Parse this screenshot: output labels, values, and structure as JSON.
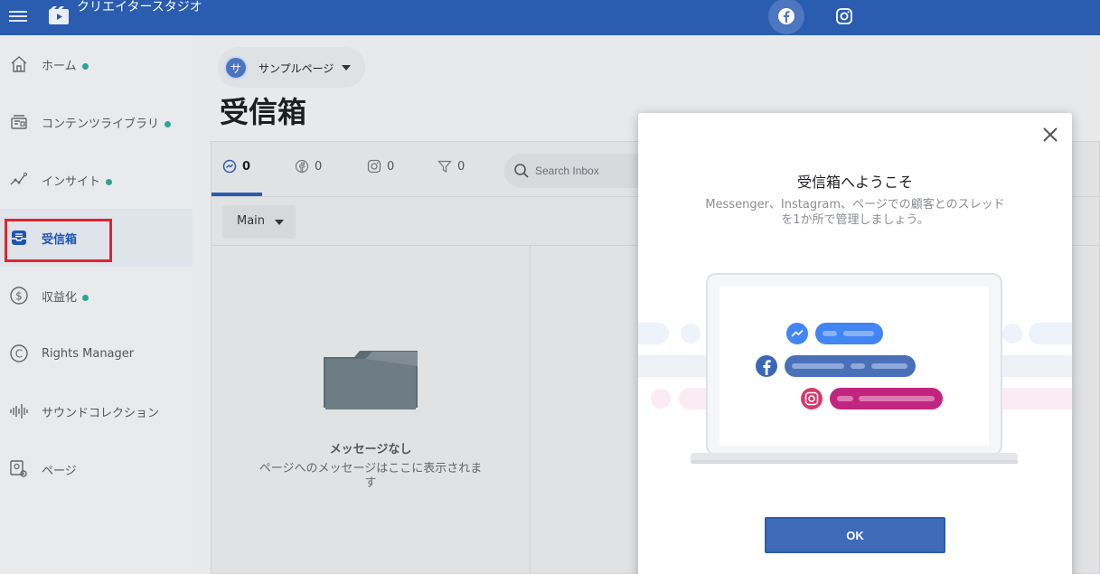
{
  "app": {
    "title": "クリエイタースタジオ"
  },
  "sidebar": {
    "items": [
      {
        "label": "ホーム",
        "dot": true
      },
      {
        "label": "コンテンツライブラリ",
        "dot": true
      },
      {
        "label": "インサイト",
        "dot": true
      },
      {
        "label": "受信箱",
        "dot": false,
        "active": true
      },
      {
        "label": "収益化",
        "dot": true
      },
      {
        "label": "Rights Manager",
        "dot": false
      },
      {
        "label": "サウンドコレクション",
        "dot": false
      },
      {
        "label": "ページ",
        "dot": false
      }
    ]
  },
  "page_selector": {
    "avatar_letter": "サ",
    "name": "サンプルページ"
  },
  "inbox": {
    "title": "受信箱",
    "tabs": [
      {
        "icon": "messenger-icon",
        "count": "0"
      },
      {
        "icon": "facebook-icon",
        "count": "0"
      },
      {
        "icon": "instagram-icon",
        "count": "0"
      },
      {
        "icon": "filter-icon",
        "count": "0"
      }
    ],
    "search_placeholder": "Search Inbox",
    "folder_label": "Main",
    "empty": {
      "title": "メッセージなし",
      "description": "ページへのメッセージはここに表示されます"
    }
  },
  "modal": {
    "title": "受信箱へようこそ",
    "description": "Messenger、Instagram、ページでの顧客とのスレッドを1か所で管理しましょう。",
    "ok_label": "OK"
  },
  "colors": {
    "topbar": "#2a5cb0",
    "accent": "#1e56b3",
    "status_dot": "#2aa695",
    "highlight_box": "#e0262c",
    "instagram_pill": "#c0267f"
  }
}
